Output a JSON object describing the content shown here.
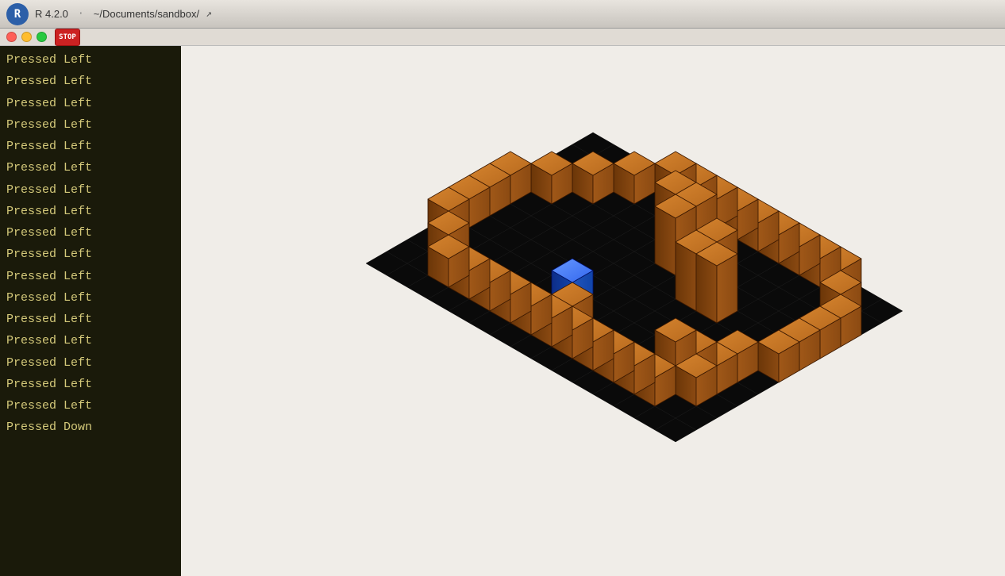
{
  "titlebar": {
    "logo_label": "R",
    "version": "R 4.2.0",
    "separator": "·",
    "path": "~/Documents/sandbox/",
    "arrow": "↗"
  },
  "window_controls": {
    "stop_label": "STOP",
    "close_label": "×"
  },
  "console": {
    "lines": [
      "Pressed Left",
      "Pressed Left",
      "Pressed Left",
      "Pressed Left",
      "Pressed Left",
      "Pressed Left",
      "Pressed Left",
      "Pressed Left",
      "Pressed Left",
      "Pressed Left",
      "Pressed Left",
      "Pressed Left",
      "Pressed Left",
      "Pressed Left",
      "Pressed Left",
      "Pressed Left",
      "Pressed Left",
      "Pressed Down"
    ]
  },
  "colors": {
    "console_bg": "#1a1a0a",
    "console_text": "#d4c97a",
    "game_bg": "#f0ede8",
    "brick_top": "#c8762a",
    "brick_left": "#8b4a12",
    "brick_right": "#a85e1a",
    "player_top": "#4488ff",
    "player_left": "#1144aa",
    "player_right": "#2266cc"
  }
}
